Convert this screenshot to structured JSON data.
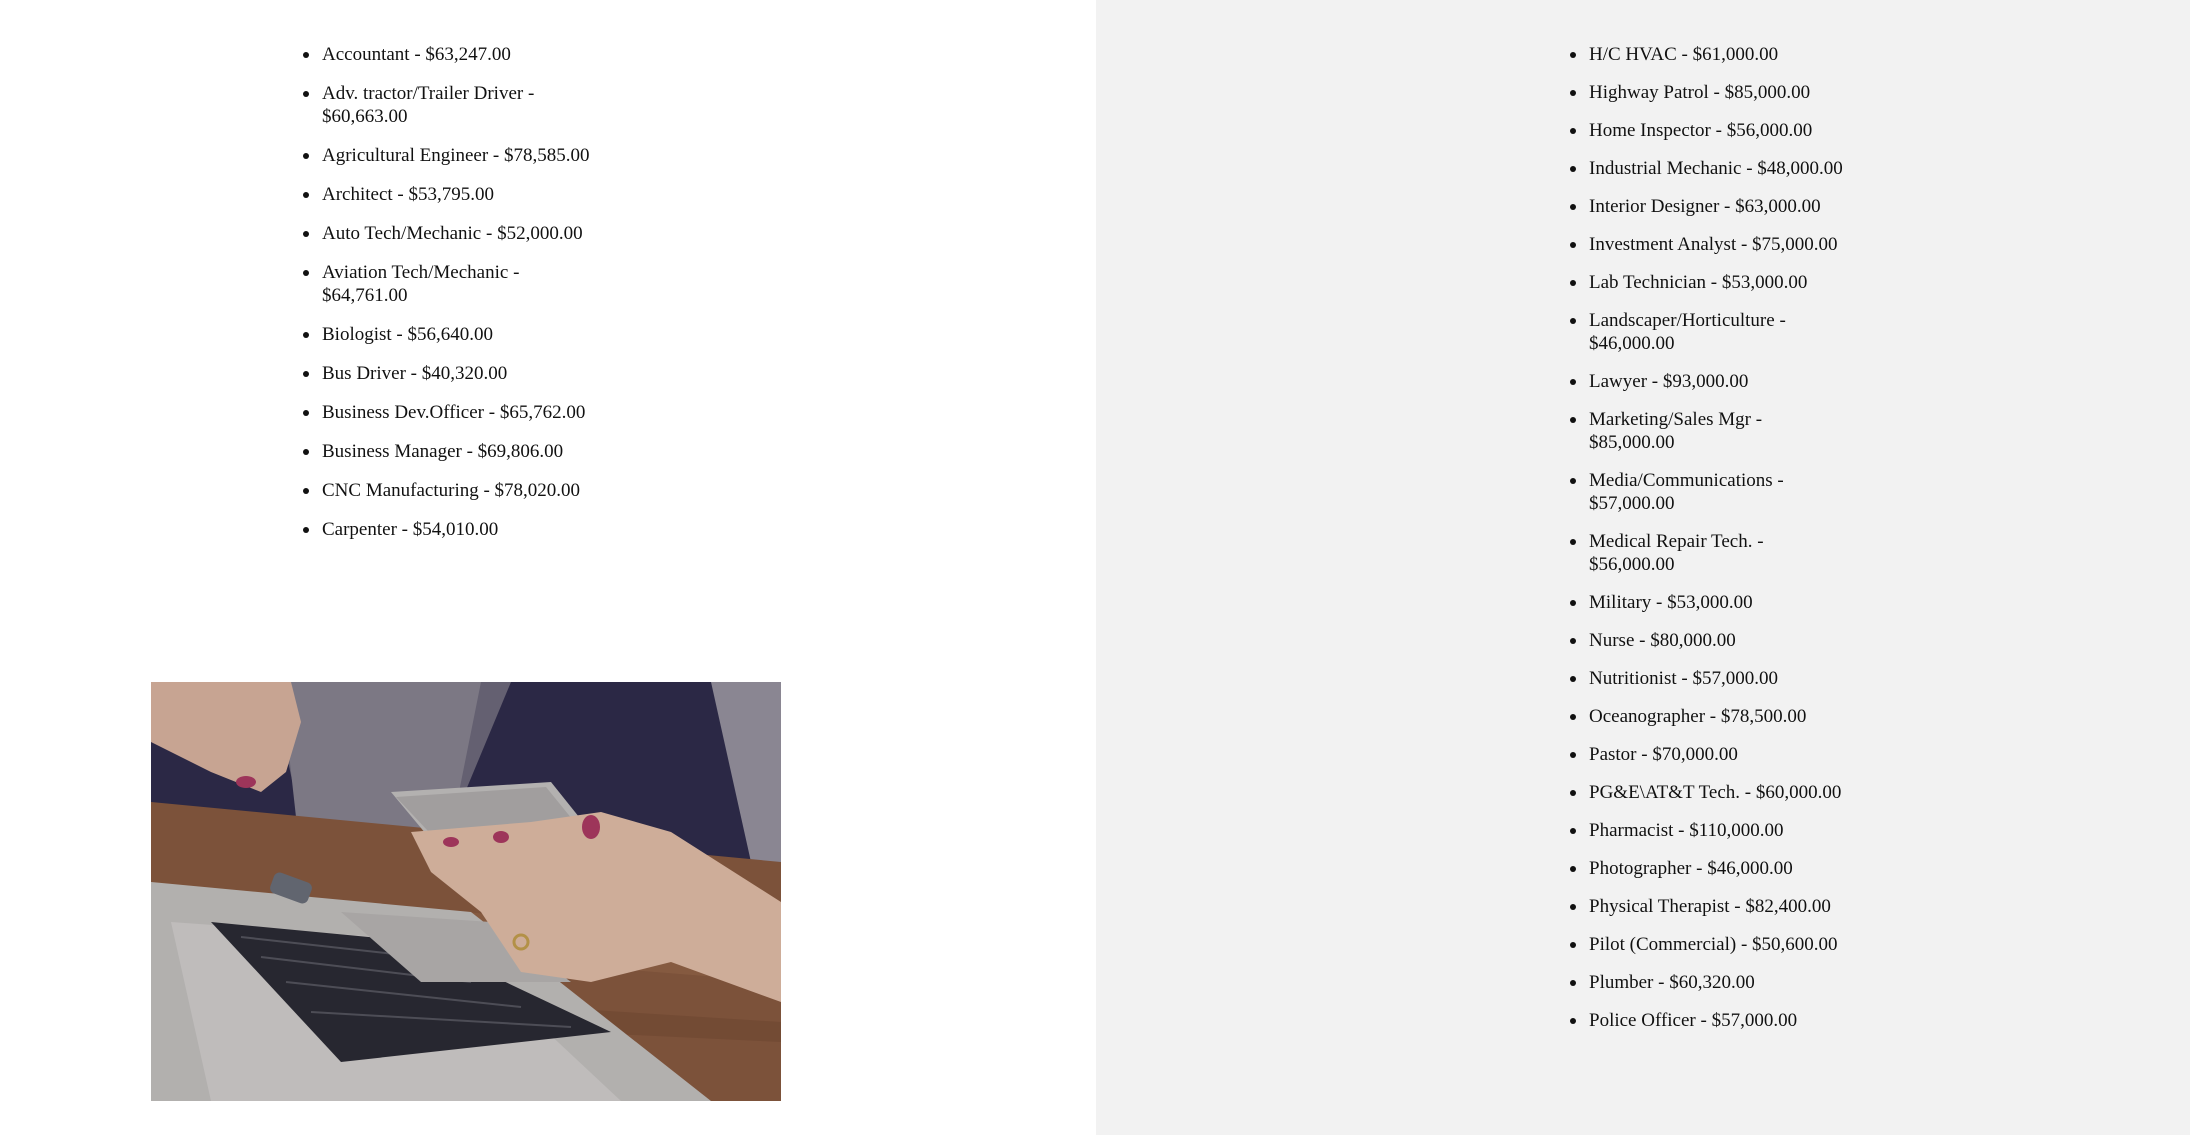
{
  "left_list": {
    "items": [
      "Accountant - $63,247.00",
      "Adv. tractor/Trailer Driver - $60,663.00",
      "Agricultural Engineer - $78,585.00",
      "Architect - $53,795.00",
      "Auto Tech/Mechanic - $52,000.00",
      "Aviation Tech/Mechanic - $64,761.00",
      "Biologist - $56,640.00",
      "Bus Driver - $40,320.00",
      "Business Dev.Officer - $65,762.00",
      "Business Manager - $69,806.00",
      "CNC Manufacturing - $78,020.00",
      "Carpenter - $54,010.00"
    ]
  },
  "right_list": {
    "items": [
      "H/C HVAC - $61,000.00",
      "Highway Patrol - $85,000.00",
      "Home Inspector - $56,000.00",
      "Industrial Mechanic - $48,000.00",
      "Interior Designer - $63,000.00",
      "Investment Analyst - $75,000.00",
      "Lab Technician - $53,000.00",
      "Landscaper/Horticulture - $46,000.00",
      "Lawyer - $93,000.00",
      "Marketing/Sales Mgr - $85,000.00",
      "Media/Communications - $57,000.00",
      "Medical Repair Tech. - $56,000.00",
      "Military - $53,000.00",
      "Nurse - $80,000.00",
      "Nutritionist - $57,000.00",
      "Oceanographer - $78,500.00",
      "Pastor - $70,000.00",
      "PG&E\\AT&T Tech. - $60,000.00",
      "Pharmacist - $110,000.00",
      "Photographer - $46,000.00",
      "Physical Therapist - $82,400.00",
      "Pilot (Commercial) - $50,600.00",
      "Plumber - $60,320.00",
      "Police Officer - $57,000.00"
    ]
  },
  "colors": {
    "left_background": "#ffffff",
    "right_background": "#f2f2f2",
    "text": "#111111"
  }
}
